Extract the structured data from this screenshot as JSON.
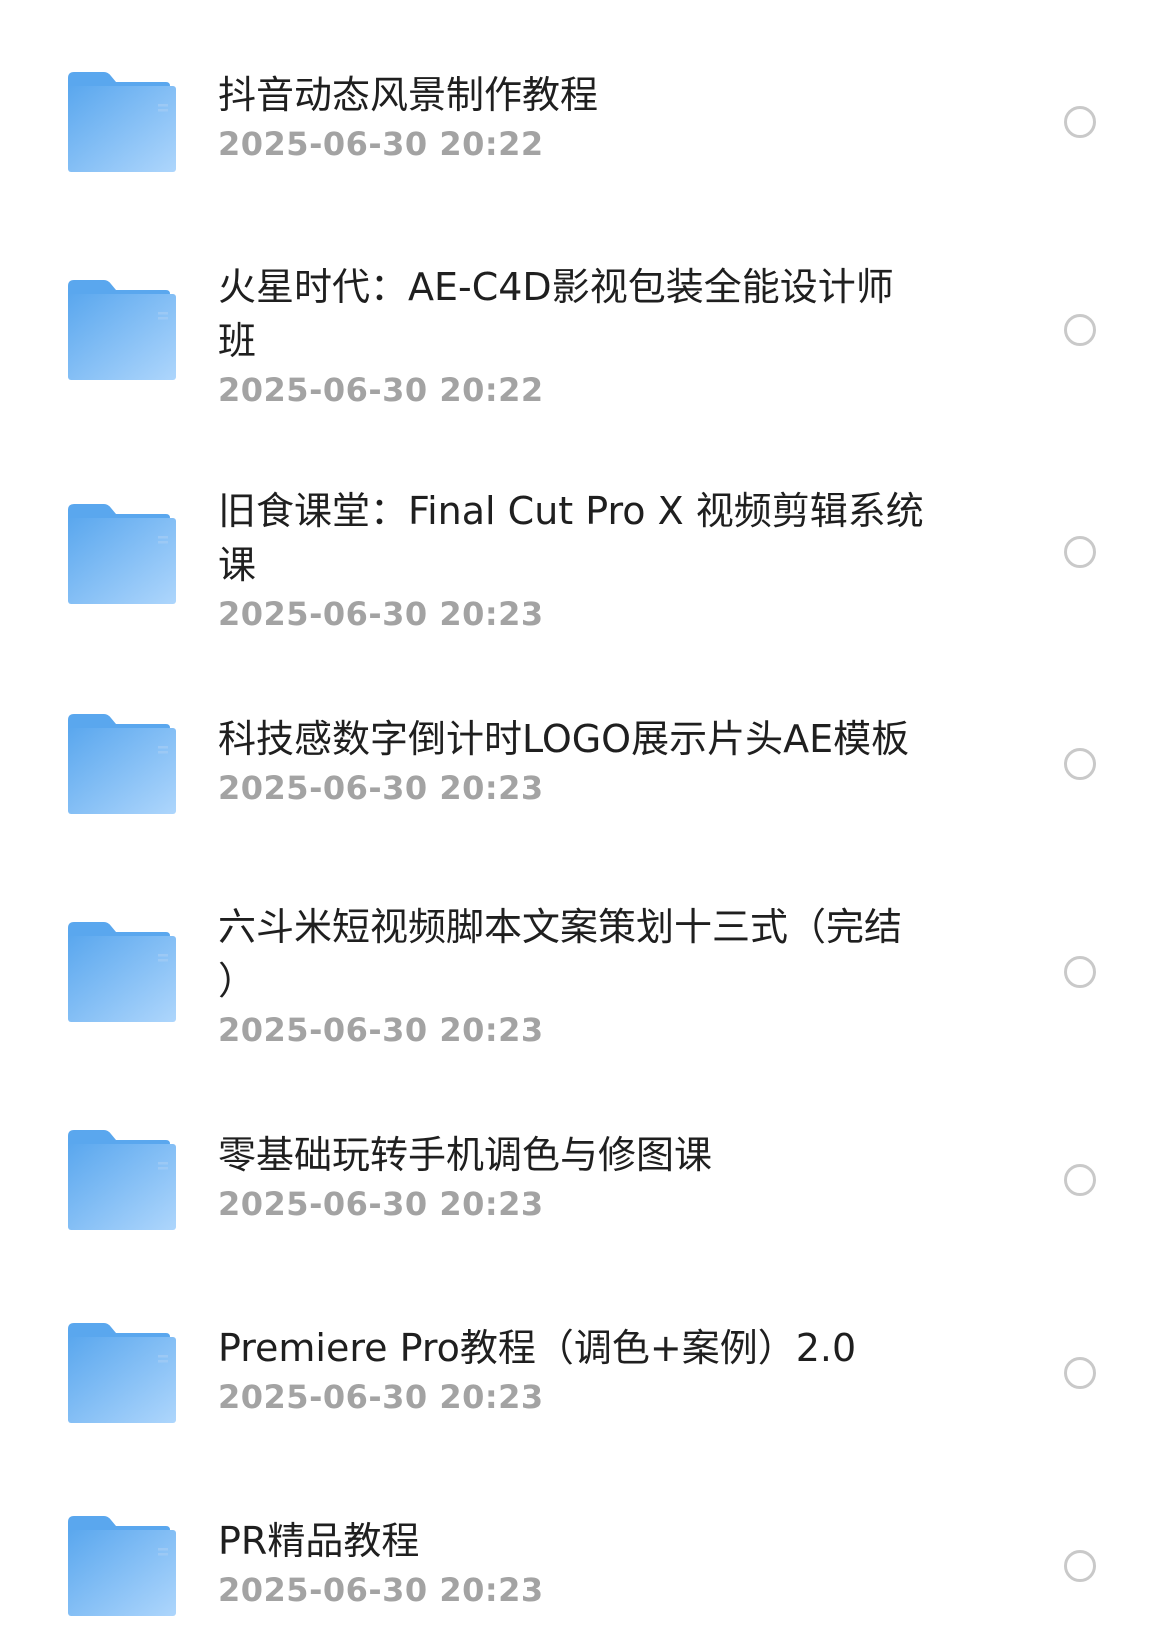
{
  "files": [
    {
      "name": "抖音动态风景制作教程",
      "time": "2025-06-30 20:22"
    },
    {
      "name": "火星时代：AE-C4D影视包装全能设计师\n班",
      "time": "2025-06-30 20:22"
    },
    {
      "name": "旧食课堂：Final Cut Pro X 视频剪辑系统\n课",
      "time": "2025-06-30 20:23"
    },
    {
      "name": "科技感数字倒计时LOGO展示片头AE模板",
      "time": "2025-06-30 20:23"
    },
    {
      "name": "六斗米短视频脚本文案策划十三式（完结\n）",
      "time": "2025-06-30 20:23"
    },
    {
      "name": "零基础玩转手机调色与修图课",
      "time": "2025-06-30 20:23"
    },
    {
      "name": "Premiere Pro教程（调色+案例）2.0",
      "time": "2025-06-30 20:23"
    },
    {
      "name": "PR精品教程",
      "time": "2025-06-30 20:23"
    }
  ],
  "icons": {
    "folder": "folder-icon",
    "select": "radio-circle-icon"
  },
  "colors": {
    "folder_light": "#a9d3fb",
    "folder_dark": "#5aa7ee",
    "name_text": "#1f1f1f",
    "time_text": "#a3a3a3",
    "radio_border": "#c9c9c9"
  }
}
